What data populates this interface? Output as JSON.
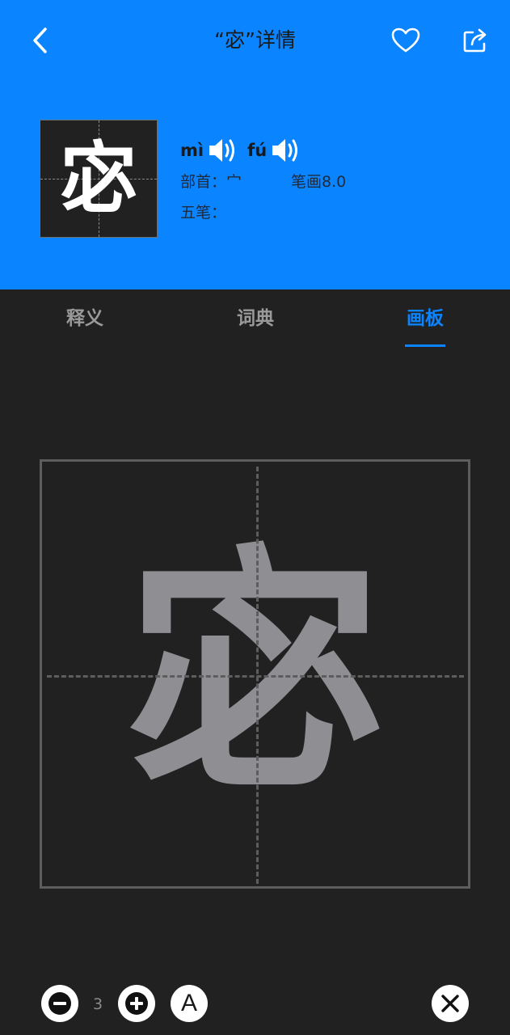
{
  "header": {
    "title": "“宓”详情",
    "bg_color": "#0a84ff"
  },
  "character": {
    "glyph": "宓",
    "pinyin": [
      {
        "text": "mì",
        "icon": "speaker-icon"
      },
      {
        "text": "fú",
        "icon": "speaker-icon"
      }
    ],
    "radical_label": "部首：宀",
    "strokes_label": "笔画8.0",
    "wubi_label": "五笔："
  },
  "tabs": [
    {
      "label": "释义",
      "active": false
    },
    {
      "label": "词典",
      "active": false
    },
    {
      "label": "画板",
      "active": true
    }
  ],
  "board": {
    "glyph": "宓",
    "glyph_color": "#8e8e93"
  },
  "controls": {
    "brush_width": "3",
    "font_button_label": "A"
  }
}
